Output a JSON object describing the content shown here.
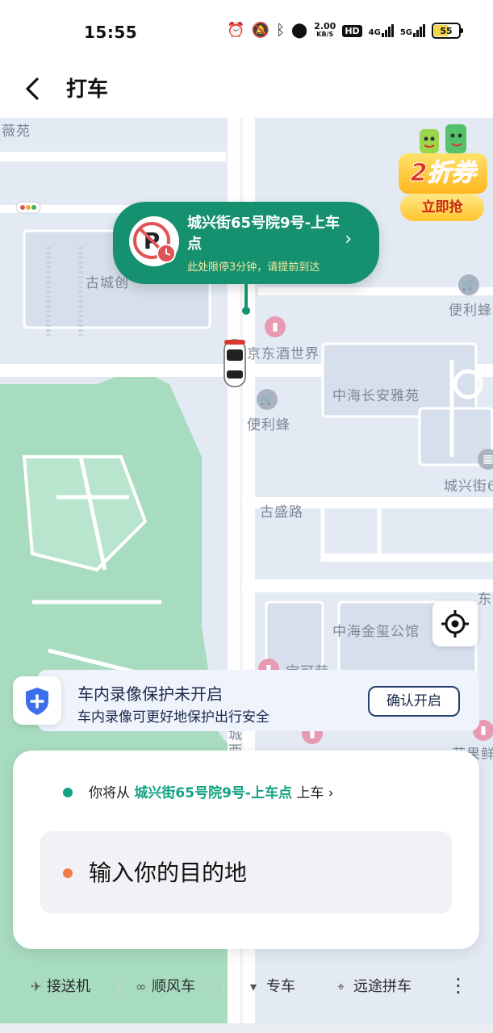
{
  "status": {
    "time": "15:55",
    "speed_value": "2.00",
    "speed_unit": "KB/S",
    "hd_label": "HD",
    "net1": "4G",
    "net2": "5G",
    "battery": "55"
  },
  "header": {
    "back_icon": "chevron-left-icon",
    "title": "打车"
  },
  "map": {
    "labels": {
      "weiyuan": "薇苑",
      "gucheng": "古城创",
      "bianlifeng1": "便利蜂",
      "jiujiu": "京东酒世界",
      "zhonghai_changan": "中海长安雅苑",
      "bianlifeng2": "便利蜂",
      "chengxingjie": "城兴街6",
      "gusheng_road": "古盛路",
      "zhonghai_jinxi": "中海金玺公馆",
      "kekemeng": "宝可萌",
      "dong": "东",
      "chengxi_v1": "城",
      "chengxi_v2": "西",
      "fruit": "苹果鲜"
    }
  },
  "promo": {
    "title": "2折券",
    "button": "立即抢"
  },
  "pickup": {
    "name": "城兴街65号院9号-上车点",
    "note": "此处限停3分钟，请提前到达",
    "icon": "no-parking-icon"
  },
  "safety": {
    "title": "车内录像保护未开启",
    "subtitle": "车内录像可更好地保护出行安全",
    "button": "确认开启",
    "icon": "shield-plus-icon"
  },
  "trip": {
    "from_prefix": "你将从",
    "from_location": "城兴街65号院9号-上车点",
    "from_suffix": "上车",
    "dest_placeholder": "输入你的目的地"
  },
  "bottom_nav": {
    "items": [
      {
        "label": "接送机",
        "icon": "plane-icon"
      },
      {
        "label": "顺风车",
        "icon": "carpool-icon"
      },
      {
        "label": "专车",
        "icon": "tie-icon"
      },
      {
        "label": "远途拼车",
        "icon": "location-icon"
      }
    ],
    "more_icon": "more-vertical-icon"
  },
  "colors": {
    "brand_green": "#16916f",
    "accent_orange": "#f07b4a",
    "map_bg": "#e3eaf4",
    "park_green": "#a8dcc0"
  }
}
